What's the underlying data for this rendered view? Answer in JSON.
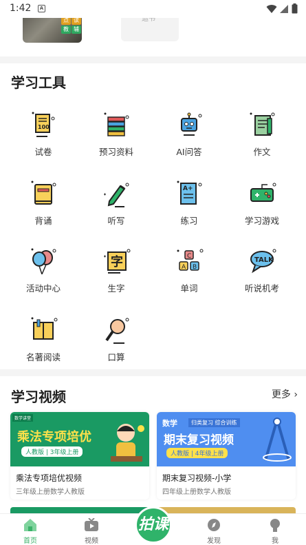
{
  "status_bar": {
    "time": "1:42",
    "notif_icon": "A"
  },
  "top_card": {
    "tag1": "点",
    "tag2": "读",
    "tag3": "教",
    "tag4": "辅",
    "gray_text": "运书"
  },
  "tools_section": {
    "title": "学习工具",
    "items": [
      {
        "label": "试卷",
        "icon": "exam-paper-icon"
      },
      {
        "label": "预习资料",
        "icon": "book-stack-icon"
      },
      {
        "label": "AI问答",
        "icon": "robot-icon"
      },
      {
        "label": "作文",
        "icon": "essay-icon"
      },
      {
        "label": "背诵",
        "icon": "recite-book-icon"
      },
      {
        "label": "听写",
        "icon": "pencil-icon"
      },
      {
        "label": "练习",
        "icon": "practice-paper-icon"
      },
      {
        "label": "学习游戏",
        "icon": "gamepad-icon"
      },
      {
        "label": "活动中心",
        "icon": "balloons-icon"
      },
      {
        "label": "生字",
        "icon": "character-card-icon"
      },
      {
        "label": "单词",
        "icon": "letter-blocks-icon"
      },
      {
        "label": "听说机考",
        "icon": "talk-bubble-icon"
      },
      {
        "label": "名著阅读",
        "icon": "open-book-icon"
      },
      {
        "label": "口算",
        "icon": "magnifier-icon"
      }
    ]
  },
  "video_section": {
    "title": "学习视频",
    "more": "更多",
    "cards": [
      {
        "title": "乘法专项培优视频",
        "subtitle": "三年级上册数学人教版",
        "banner_title": "乘法专项培优",
        "banner_tag": "人教版 | 3年级上册",
        "banner_corner": "数学讲堂"
      },
      {
        "title": "期末复习视频-小学",
        "subtitle": "四年级上册数学人教版",
        "banner_title": "期末复习视频",
        "banner_tag": "人教版 | 4年级上册",
        "banner_corner": "数学",
        "banner_sub": "归类复习 综合训练"
      }
    ]
  },
  "tabbar": {
    "home": "首页",
    "video": "视频",
    "center": "拍课",
    "discover": "发现",
    "me": "我"
  },
  "colors": {
    "accent": "#3bb36a",
    "video1_bg": "#1a9a63",
    "video2_bg": "#4f8ef0"
  }
}
